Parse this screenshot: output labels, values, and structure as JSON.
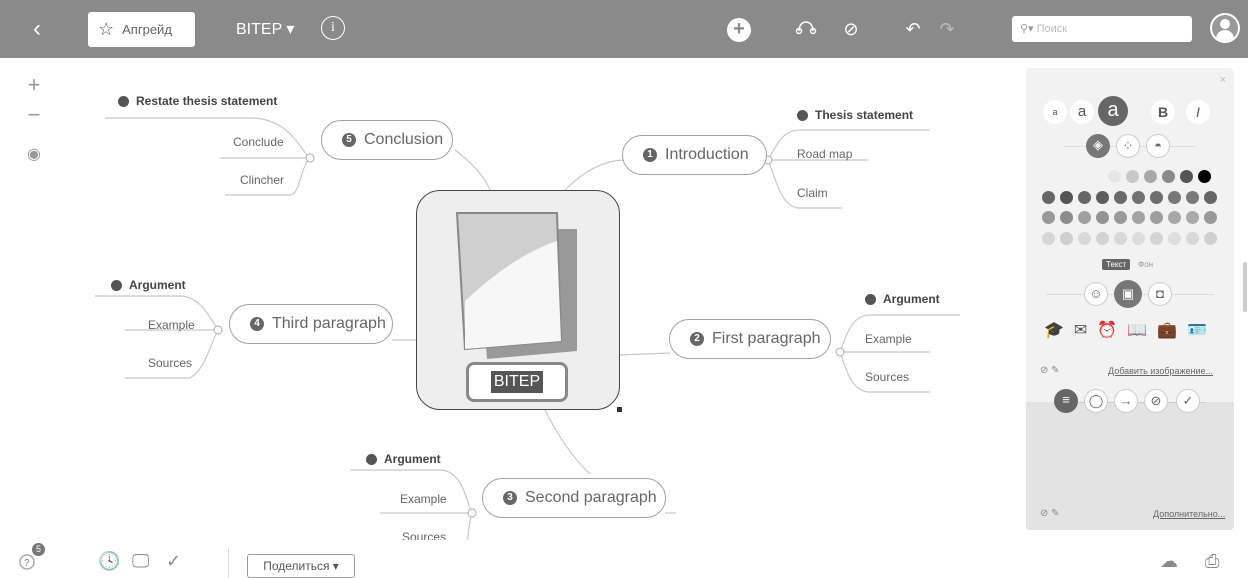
{
  "topbar": {
    "upgrade_label": "Апгрейд",
    "map_title": "BITEP ▾",
    "search_placeholder": "Поиск"
  },
  "mindmap": {
    "central": "BITEP",
    "branches": [
      {
        "num": "1",
        "title": "Introduction",
        "leaves": [
          "Thesis statement",
          "Road map",
          "Claim"
        ]
      },
      {
        "num": "2",
        "title": "First paragraph",
        "leaves": [
          "Argument",
          "Example",
          "Sources"
        ]
      },
      {
        "num": "3",
        "title": "Second paragraph",
        "leaves": [
          "Argument",
          "Example",
          "Sources"
        ]
      },
      {
        "num": "4",
        "title": "Third paragraph",
        "leaves": [
          "Argument",
          "Example",
          "Sources"
        ]
      },
      {
        "num": "5",
        "title": "Conclusion",
        "leaves": [
          "Restate thesis statement",
          "Conclude",
          "Clincher"
        ]
      }
    ]
  },
  "panel": {
    "font_sizes": [
      "a",
      "a",
      "a"
    ],
    "bold": "B",
    "italic": "I",
    "text_tab": "Текст",
    "bg_tab": "Фон",
    "add_image_link": "Добавить изображение...",
    "more_link": "Дополнительно..."
  },
  "bottombar": {
    "share_label": "Поделиться ▾",
    "badge_count": "5"
  }
}
